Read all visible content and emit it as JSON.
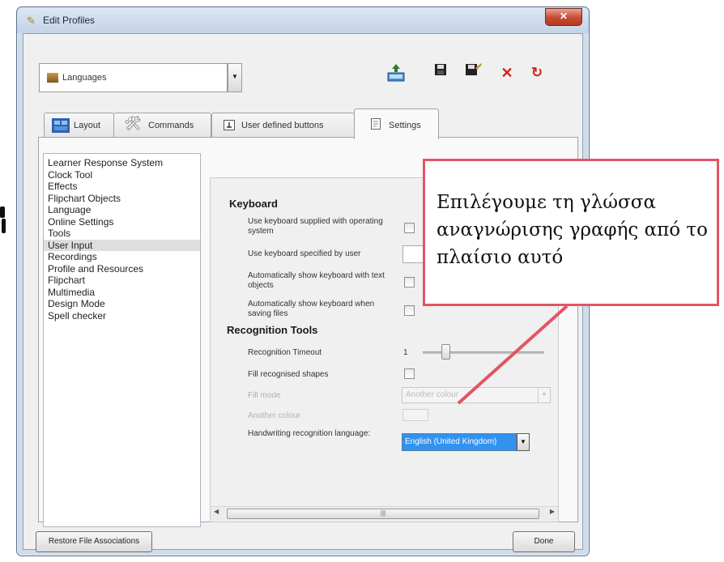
{
  "window": {
    "title": "Edit Profiles",
    "close_glyph": "✕"
  },
  "profile": {
    "selected": "Languages"
  },
  "toolbar": {
    "icons": [
      "export-icon",
      "save-icon",
      "save-as-icon",
      "delete-icon",
      "reset-icon"
    ],
    "accent": "#d4241b"
  },
  "tabs": [
    {
      "label": "Layout"
    },
    {
      "label": "Commands"
    },
    {
      "label": "User defined buttons"
    },
    {
      "label": "Settings",
      "active": true
    }
  ],
  "categories": [
    "Learner Response System",
    "Clock Tool",
    "Effects",
    "Flipchart Objects",
    "Language",
    "Online Settings",
    "Tools",
    "User Input",
    "Recordings",
    "Profile and Resources",
    "Flipchart",
    "Multimedia",
    "Design Mode",
    "Spell checker"
  ],
  "selected_category": "User Input",
  "keyboard": {
    "title": "Keyboard",
    "use_os_keyboard": "Use keyboard supplied with operating system",
    "use_user_keyboard": "Use keyboard specified by user",
    "auto_show_text": "Automatically show keyboard with text objects",
    "auto_show_saving": "Automatically show keyboard when saving files"
  },
  "recognition": {
    "title": "Recognition Tools",
    "timeout_label": "Recognition Timeout",
    "timeout_value": "1",
    "fill_shapes": "Fill recognised shapes",
    "fill_mode": "Fill mode",
    "fill_mode_value": "Another colour",
    "another_colour": "Another colour",
    "hw_language_label": "Handwriting recognition language:",
    "hw_language_value": "English (United Kingdom)"
  },
  "buttons": {
    "restore": "Restore File Associations",
    "done": "Done"
  },
  "callout": {
    "text": "Επιλέγουμε τη γλώσσα αναγνώρισης γραφής από το πλαίσιο αυτό",
    "color": "#e25563"
  }
}
